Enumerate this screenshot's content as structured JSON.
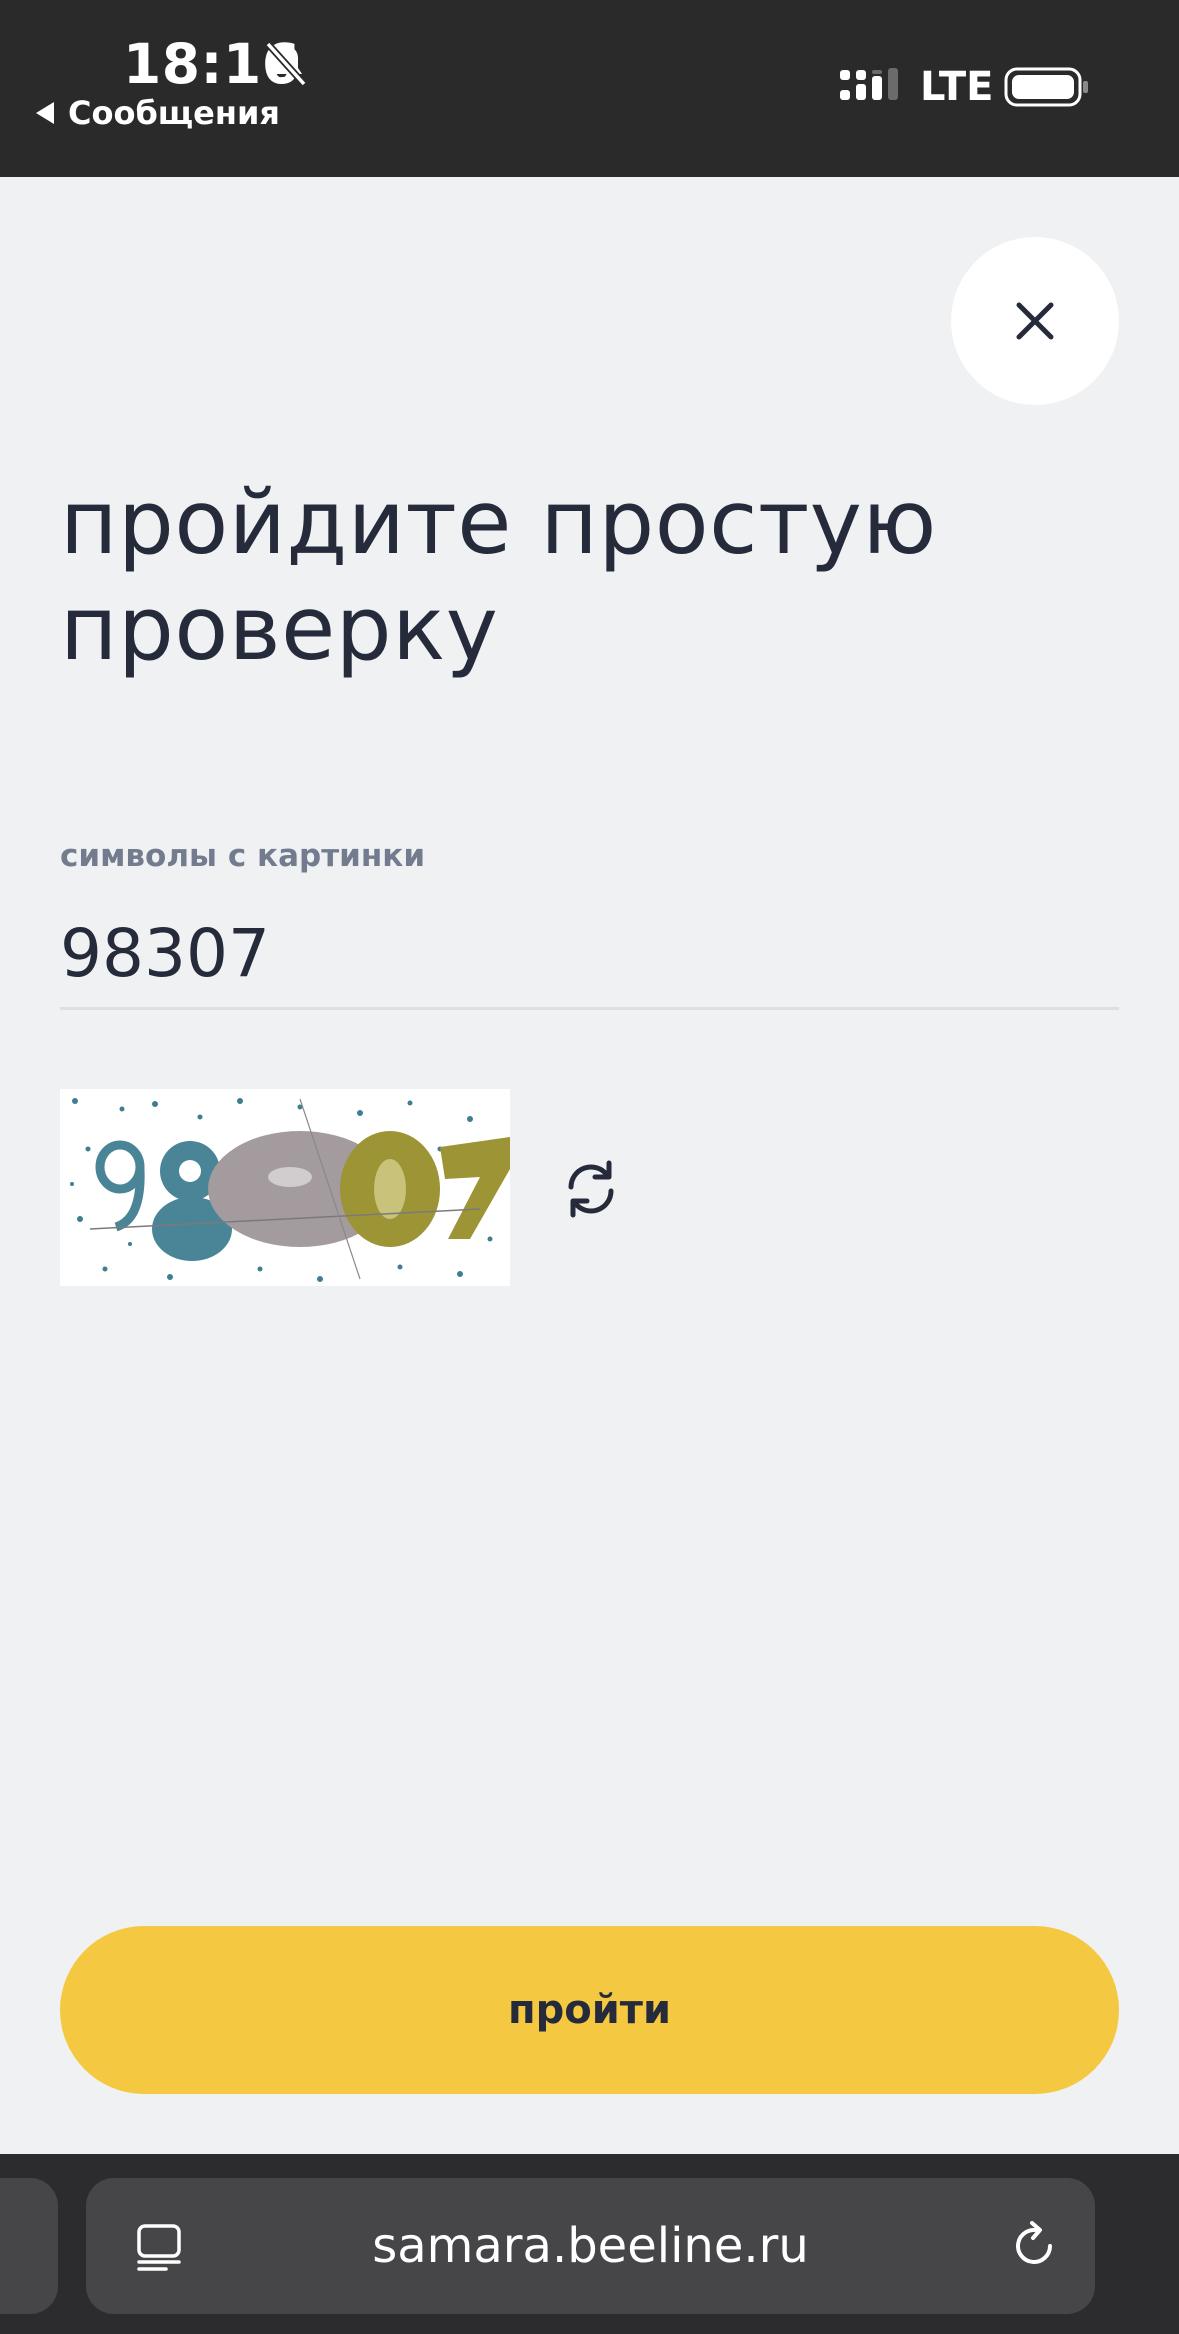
{
  "status_bar": {
    "time": "18:16",
    "back_label": "Сообщения",
    "network": "LTE"
  },
  "dialog": {
    "title": "пройдите простую проверку",
    "field_label": "символы с картинки",
    "field_value": "98307",
    "captcha_text": "98307",
    "submit_label": "пройти"
  },
  "browser": {
    "url": "samara.beeline.ru"
  },
  "colors": {
    "accent": "#f5c842",
    "text": "#252b3a",
    "background": "#f0f1f3"
  }
}
